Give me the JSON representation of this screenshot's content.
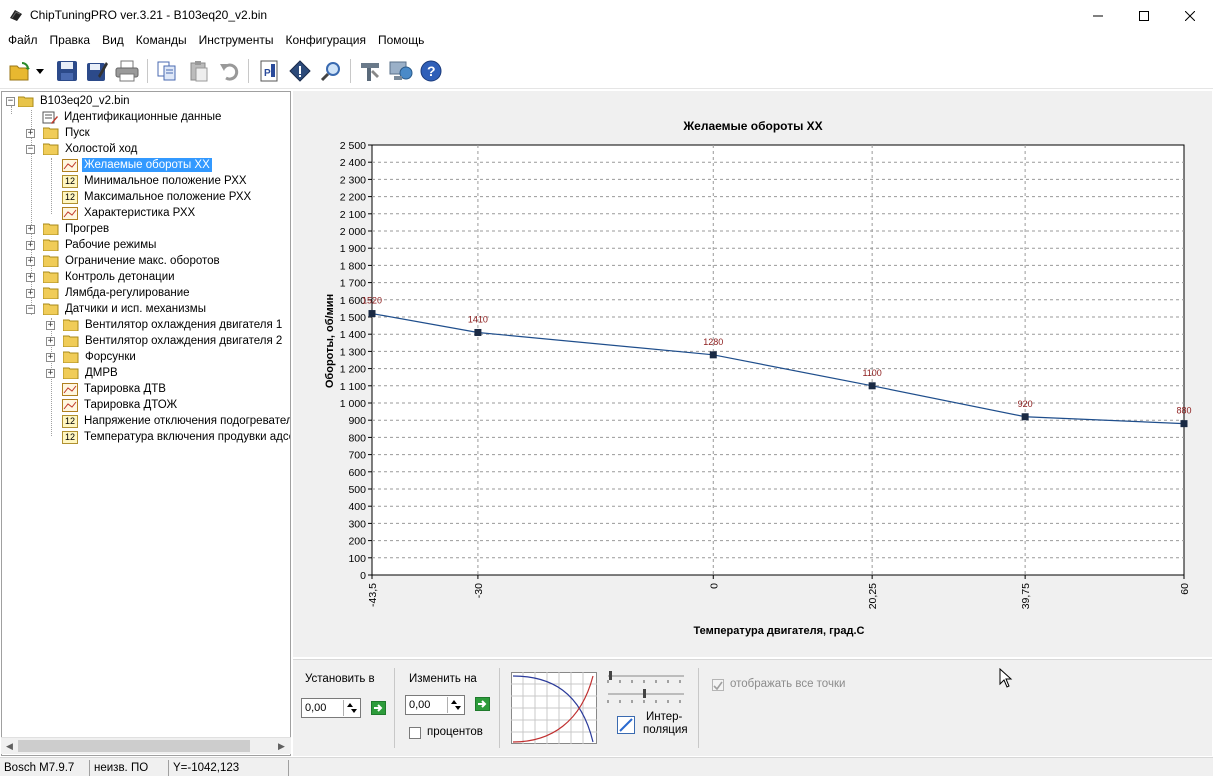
{
  "window": {
    "title": "ChipTuningPRO ver.3.21 - B103eq20_v2.bin",
    "minimize": "—",
    "maximize": "☐",
    "close": "✕"
  },
  "menu": [
    "Файл",
    "Правка",
    "Вид",
    "Команды",
    "Инструменты",
    "Конфигурация",
    "Помощь"
  ],
  "toolbar": {
    "icons": [
      "open-icon",
      "save-icon",
      "save-as-icon",
      "print-icon",
      "copy-icon",
      "paste-icon",
      "undo-icon",
      "pdf-icon",
      "info-icon",
      "zoom-icon",
      "tools-icon",
      "connect-icon",
      "help-icon"
    ]
  },
  "tree": {
    "root": "B103eq20_v2.bin",
    "items": [
      {
        "label": "Идентификационные данные"
      },
      {
        "label": "Пуск"
      },
      {
        "label": "Холостой ход"
      },
      {
        "label": "Желаемые обороты ХХ"
      },
      {
        "label": "Минимальное положение РХХ"
      },
      {
        "label": "Максимальное положение РХХ"
      },
      {
        "label": "Характеристика РХХ"
      },
      {
        "label": "Прогрев"
      },
      {
        "label": "Рабочие режимы"
      },
      {
        "label": "Ограничение макс. оборотов"
      },
      {
        "label": "Контроль детонации"
      },
      {
        "label": "Лямбда-регулирование"
      },
      {
        "label": "Датчики и исп. механизмы"
      },
      {
        "label": "Вентилятор охлаждения двигателя 1"
      },
      {
        "label": "Вентилятор охлаждения двигателя 2"
      },
      {
        "label": "Форсунки"
      },
      {
        "label": "ДМРВ"
      },
      {
        "label": "Тарировка ДТВ"
      },
      {
        "label": "Тарировка ДТОЖ"
      },
      {
        "label": "Напряжение отключения подогревателя"
      },
      {
        "label": "Температура включения продувки адсорбера"
      }
    ],
    "badge_12": "12"
  },
  "chart_data": {
    "type": "line",
    "title": "Желаемые обороты ХХ",
    "xlabel": "Температура двигателя, град.С",
    "ylabel": "Обороты, об/мин",
    "x": [
      -43.5,
      -30,
      0,
      20.25,
      39.75,
      60
    ],
    "x_tick_labels": [
      "-43,5",
      "-30",
      "0",
      "20,25",
      "39,75",
      "60"
    ],
    "values": [
      1520,
      1410,
      1280,
      1100,
      920,
      880
    ],
    "data_labels": [
      "1520",
      "1410",
      "1280",
      "1100",
      "920",
      "880"
    ],
    "ylim": [
      0,
      2500
    ],
    "y_step": 100,
    "y_tick_labels": [
      "0",
      "100",
      "200",
      "300",
      "400",
      "500",
      "600",
      "700",
      "800",
      "900",
      "1 000",
      "1 100",
      "1 200",
      "1 300",
      "1 400",
      "1 500",
      "1 600",
      "1 700",
      "1 800",
      "1 900",
      "2 000",
      "2 100",
      "2 200",
      "2 300",
      "2 400",
      "2 500"
    ],
    "grid": true,
    "colors": {
      "line": "#1f4e8c",
      "marker": "#1a2a44",
      "label": "#8b1a1a"
    }
  },
  "controls": {
    "set_label": "Установить в",
    "set_value": "0,00",
    "change_label": "Изменить на",
    "change_value": "0,00",
    "percent_label": "процентов",
    "interp_label_1": "Интер-",
    "interp_label_2": "поляция",
    "show_all_label": "отображать все точки"
  },
  "status": {
    "ecu": "Bosch M7.9.7",
    "software": "неизв. ПО",
    "coord": "Y=-1042,123"
  }
}
